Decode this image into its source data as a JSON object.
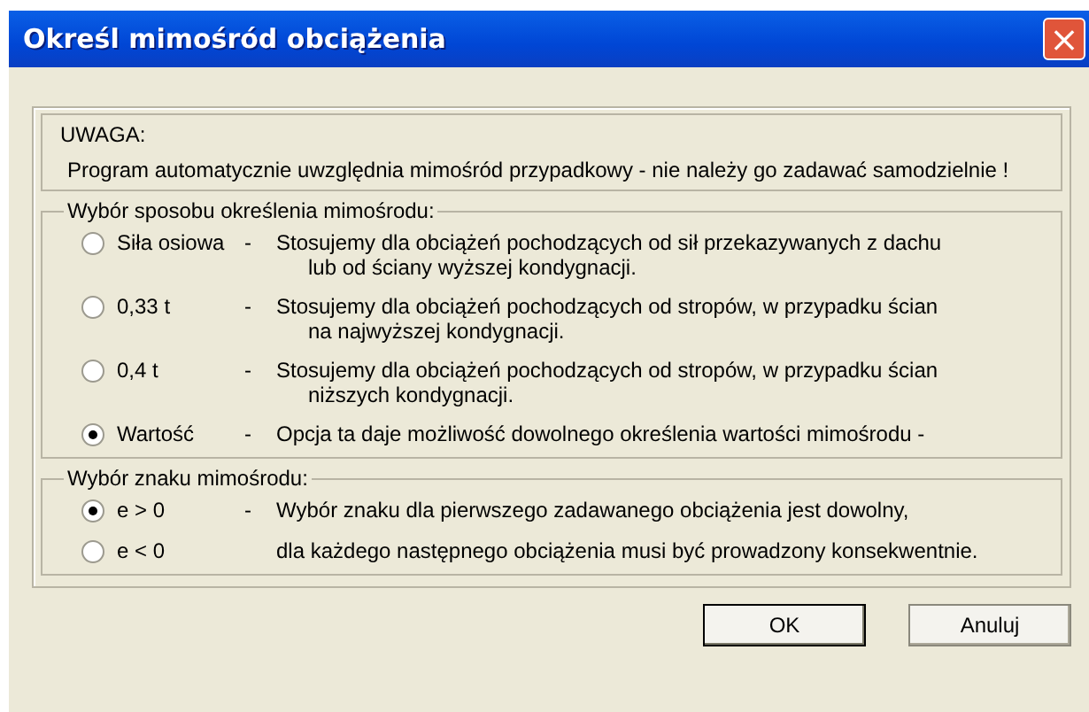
{
  "window": {
    "title": "Określ mimośród obciążenia",
    "close": "×"
  },
  "notice": {
    "heading": "UWAGA:",
    "text": "Program automatycznie uwzględnia mimośród przypadkowy - nie należy go zadawać samodzielnie !"
  },
  "method_group": {
    "title": "Wybór sposobu określenia mimośrodu:",
    "options": [
      {
        "label": "Siła osiowa",
        "dash": "-",
        "lines": [
          "Stosujemy dla obciążeń pochodzących od sił przekazywanych z dachu",
          "lub od ściany wyższej kondygnacji."
        ],
        "selected": false
      },
      {
        "label": "0,33 t",
        "dash": "-",
        "lines": [
          "Stosujemy dla obciążeń pochodzących od stropów, w przypadku ścian",
          "na najwyższej kondygnacji."
        ],
        "selected": false
      },
      {
        "label": "0,4 t",
        "dash": "-",
        "lines": [
          "Stosujemy dla obciążeń pochodzących od stropów, w przypadku ścian",
          "niższych kondygnacji."
        ],
        "selected": false
      },
      {
        "label": "Wartość",
        "dash": "-",
        "lines": [
          "Opcja ta daje możliwość dowolnego określenia wartości mimośrodu -"
        ],
        "selected": true
      }
    ]
  },
  "sign_group": {
    "title": "Wybór znaku mimośrodu:",
    "options": [
      {
        "label": "e > 0",
        "dash": "-",
        "lines": [
          "Wybór znaku dla pierwszego zadawanego obciążenia jest dowolny,"
        ],
        "selected": true
      },
      {
        "label": "e < 0",
        "lines": [
          "dla każdego następnego obciążenia musi być prowadzony konsekwentnie."
        ],
        "selected": false
      }
    ]
  },
  "buttons": [
    {
      "label": "OK",
      "default": true
    },
    {
      "label": "Anuluj",
      "default": false
    }
  ]
}
